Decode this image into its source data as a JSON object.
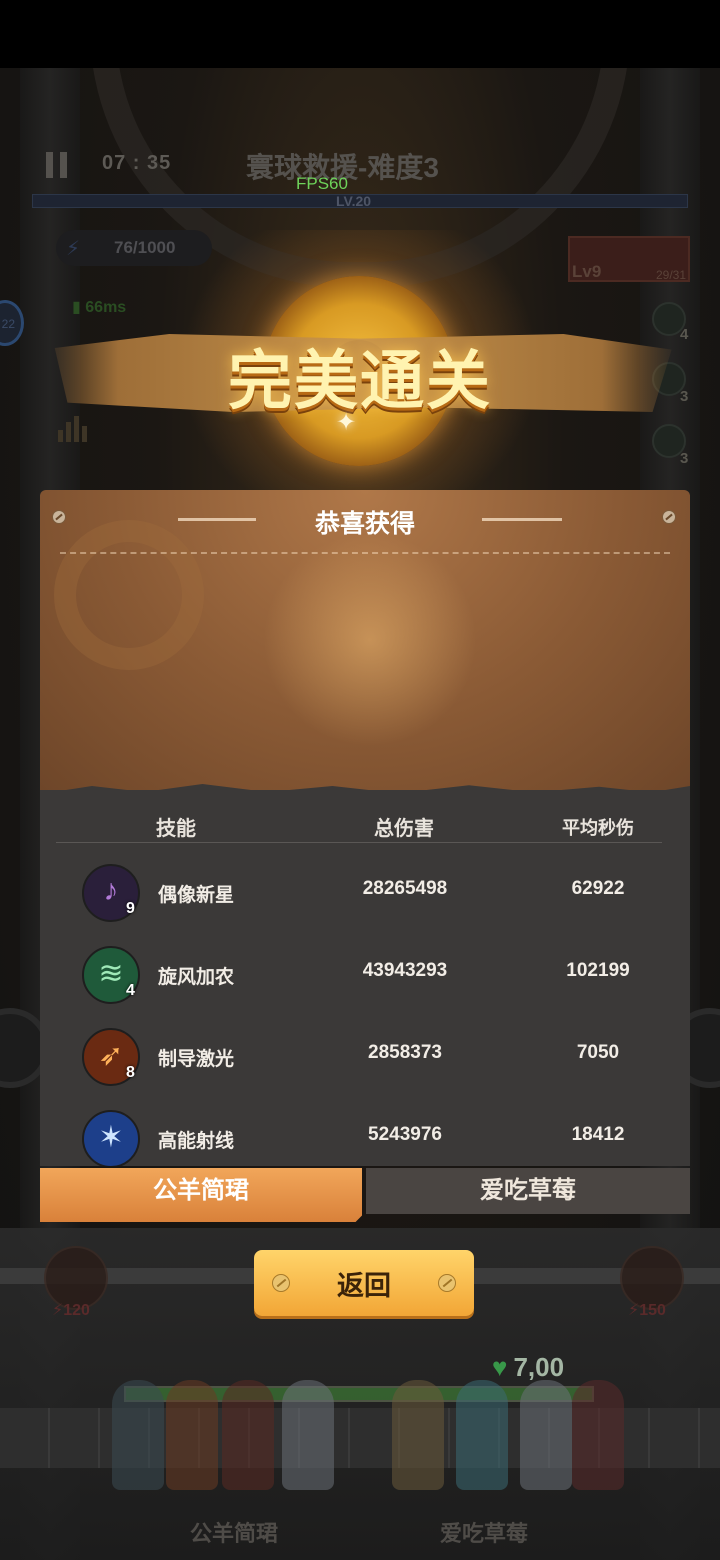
{
  "hud": {
    "timer": "07 : 35",
    "level_title": "寰球救援-难度3",
    "fps": "FPS60",
    "level_bar": "LV.20",
    "energy": "76/1000",
    "ping": "66ms",
    "side_badge": "22",
    "weapon_level": "Lv9",
    "weapon_count": "29/31",
    "mini_counts": [
      "4",
      "3",
      "3"
    ]
  },
  "banner": {
    "title": "完美通关"
  },
  "panel": {
    "title": "恭喜获得"
  },
  "table": {
    "headers": {
      "skill": "技能",
      "total": "总伤害",
      "dps": "平均秒伤"
    },
    "rows": [
      {
        "name": "偶像新星",
        "level": "9",
        "total": "28265498",
        "dps": "62922",
        "icon": "guitar-icon",
        "color": "#2a1f3a"
      },
      {
        "name": "旋风加农",
        "level": "4",
        "total": "43943293",
        "dps": "102199",
        "icon": "tornado-icon",
        "color": "#1f5a3a"
      },
      {
        "name": "制导激光",
        "level": "8",
        "total": "2858373",
        "dps": "7050",
        "icon": "laser-icon",
        "color": "#6a2a12"
      },
      {
        "name": "高能射线",
        "level": "",
        "total": "5243976",
        "dps": "18412",
        "icon": "beam-icon",
        "color": "#1d3f8a"
      }
    ]
  },
  "tabs": {
    "player1": "公羊简珺",
    "player2": "爱吃草莓"
  },
  "return_button": "返回",
  "scene": {
    "hp": "7,00",
    "cost_left": "120",
    "cost_right": "150",
    "player1": "公羊简珺",
    "player2": "爱吃草莓"
  }
}
